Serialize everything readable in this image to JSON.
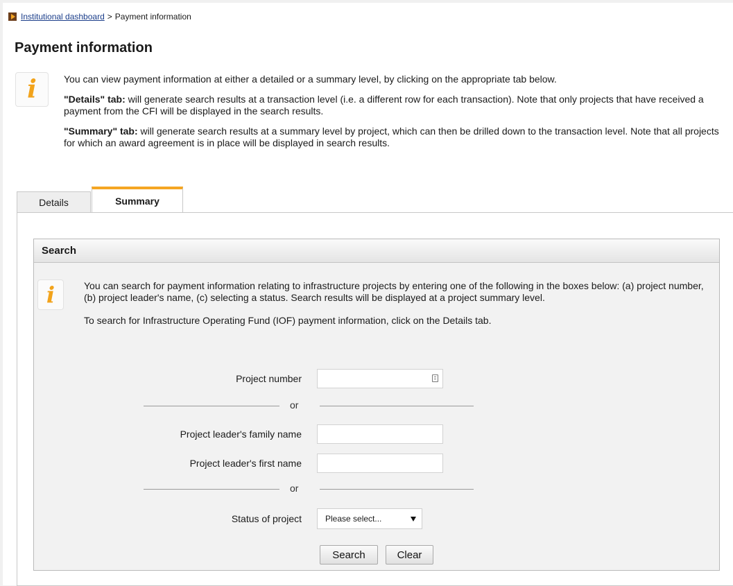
{
  "breadcrumb": {
    "icon": "breadcrumb-arrow-icon",
    "link": "Institutional dashboard",
    "separator": ">",
    "current": "Payment information"
  },
  "page": {
    "title": "Payment information"
  },
  "intro": {
    "icon": "info-icon",
    "text": "You can view payment information at either a detailed or a summary level, by clicking on the appropriate tab below.",
    "details_label": "\"Details\" tab:",
    "details_text": " will generate search results at a transaction level (i.e. a different row for each transaction). Note that only projects that have received a payment from the CFI will be displayed in the search results.",
    "summary_label": "\"Summary\" tab:",
    "summary_text": " will generate search results at a summary level by project, which can then be drilled down to the transaction level. Note that all projects for which an award agreement is in place will be displayed in search results."
  },
  "tabs": [
    {
      "label": "Details",
      "active": false
    },
    {
      "label": "Summary",
      "active": true
    }
  ],
  "search": {
    "header": "Search",
    "info_text": "You can search for payment information relating to infrastructure projects by entering one of the following in the boxes below: (a) project number, (b) project leader's name, (c) selecting a status. Search results will be displayed at a project summary level.",
    "iof_text": "To search for Infrastructure Operating Fund (IOF) payment information, click on the Details tab.",
    "project_number_label": "Project number",
    "project_number_value": "",
    "or_1": "or",
    "family_name_label": "Project leader's family name",
    "family_name_value": "",
    "first_name_label": "Project leader's first name",
    "first_name_value": "",
    "or_2": "or",
    "status_label": "Status of project",
    "status_value": "Please select...",
    "search_button": "Search",
    "clear_button": "Clear"
  },
  "colors": {
    "accent": "#f5a623",
    "link": "#1a3d8a",
    "info_icon": "#f2a31b"
  }
}
